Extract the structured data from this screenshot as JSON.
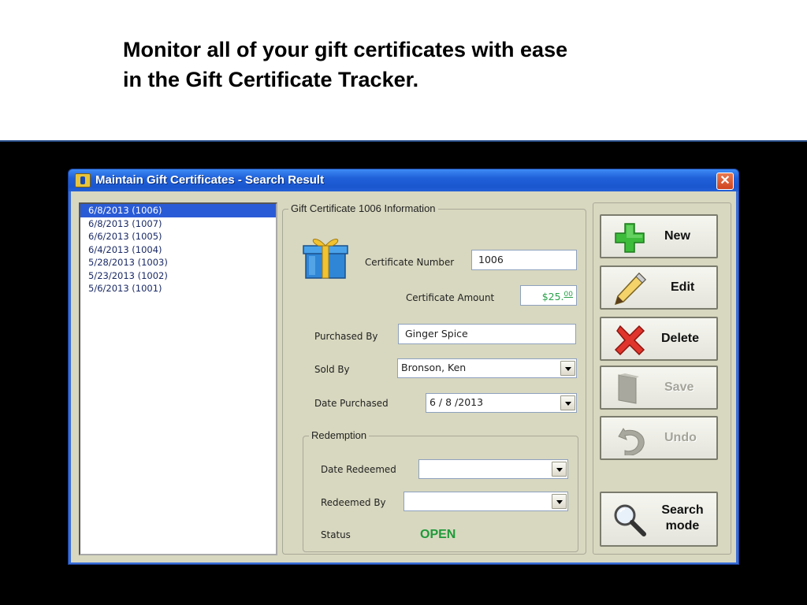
{
  "slide": {
    "title_line1": "Monitor all of your gift certificates with ease",
    "title_line2": "in the Gift Certificate Tracker."
  },
  "window": {
    "title": "Maintain Gift Certificates - Search Result",
    "close_label": "✕"
  },
  "list": {
    "items": [
      "6/8/2013 (1006)",
      "6/8/2013 (1007)",
      "6/6/2013 (1005)",
      "6/4/2013 (1004)",
      "5/28/2013 (1003)",
      "5/23/2013 (1002)",
      "5/6/2013 (1001)"
    ],
    "selected_index": 0
  },
  "info": {
    "group_title": "Gift Certificate 1006 Information",
    "certificate_number_label": "Certificate Number",
    "certificate_number_value": "1006",
    "certificate_amount_label": "Certificate Amount",
    "certificate_amount_dollars": "$25.",
    "certificate_amount_cents": "00",
    "purchased_by_label": "Purchased By",
    "purchased_by_value": "Ginger Spice",
    "sold_by_label": "Sold By",
    "sold_by_value": "Bronson, Ken",
    "date_purchased_label": "Date Purchased",
    "date_purchased_value": "6 / 8 /2013"
  },
  "redemption": {
    "group_title": "Redemption",
    "date_redeemed_label": "Date Redeemed",
    "date_redeemed_value": "",
    "redeemed_by_label": "Redeemed By",
    "redeemed_by_value": "",
    "status_label": "Status",
    "status_value": "OPEN"
  },
  "buttons": {
    "new": "New",
    "edit": "Edit",
    "delete": "Delete",
    "save": "Save",
    "undo": "Undo",
    "search_line1": "Search",
    "search_line2": "mode"
  },
  "colors": {
    "status_open": "#1f9a3a",
    "selection": "#2a5bd6",
    "titlebar": "#1f5fd8"
  }
}
